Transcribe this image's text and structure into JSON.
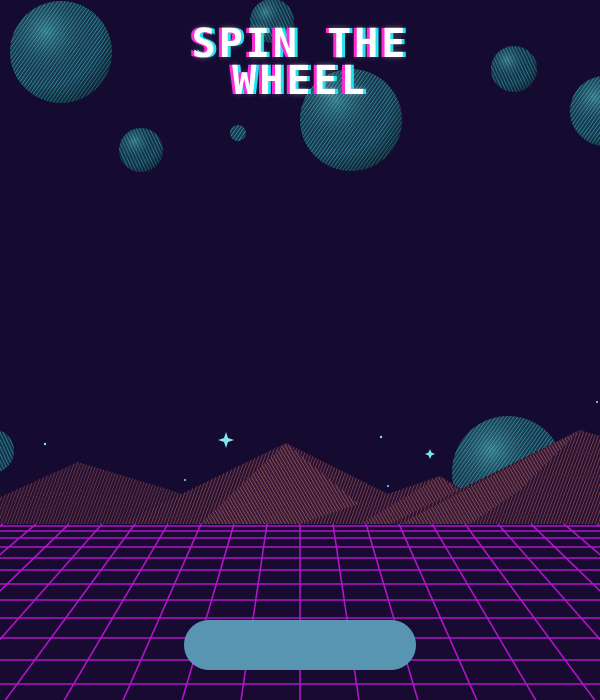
{
  "game": {
    "title": "SPIN THE\nWHEEL",
    "spin_button_label": ""
  },
  "colors": {
    "background": "#150a30",
    "planet_fill": "#1f4a63",
    "planet_line": "#46c6d6",
    "mountain": "#c4714c",
    "grid": "#b015c9",
    "button": "#5795b0",
    "title_shadow_pink": "#ff2bd6",
    "title_shadow_cyan": "#27e0f0"
  },
  "icons": {
    "planets": "sphere-planet-icon",
    "stars": "sparkle-star-icon"
  }
}
